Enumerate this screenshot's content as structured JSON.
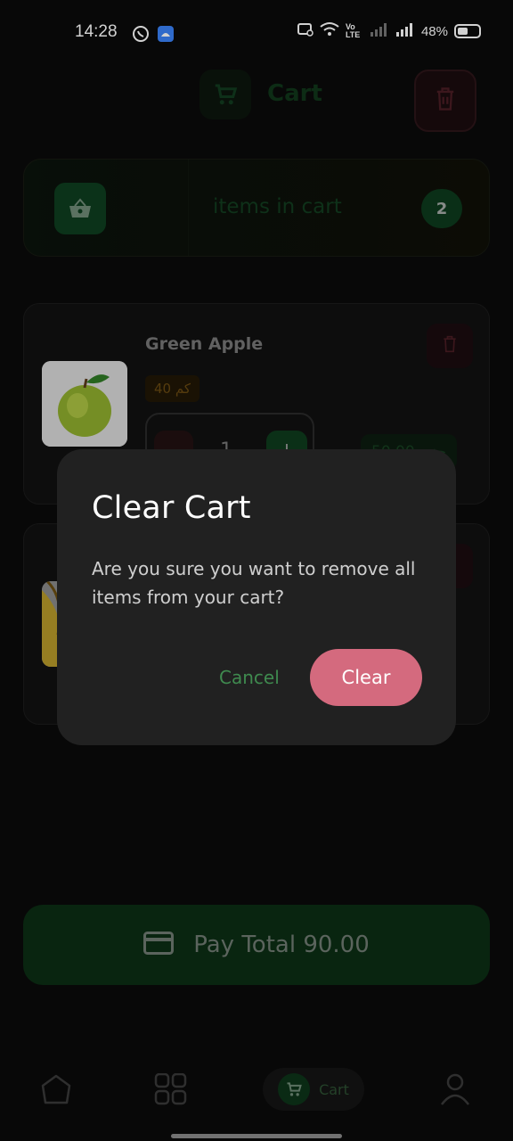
{
  "status_bar": {
    "time": "14:28",
    "battery_percent": "48%",
    "network_label": "Vo LTE"
  },
  "header": {
    "title": "Cart"
  },
  "summary": {
    "label": "items in cart",
    "count": "2"
  },
  "items": [
    {
      "name": "Green Apple",
      "unit": "40 كم",
      "quantity": "1",
      "price": "جنيه 50.00"
    },
    {
      "name": "",
      "unit": "",
      "quantity": "",
      "price": ""
    }
  ],
  "pay": {
    "label": "Pay Total 90.00"
  },
  "nav": {
    "cart_label": "Cart"
  },
  "dialog": {
    "title": "Clear Cart",
    "message": "Are you sure you want to remove all items from your cart?",
    "cancel_label": "Cancel",
    "confirm_label": "Clear"
  },
  "colors": {
    "accent_green": "#0e3b1d",
    "danger_pink": "#d46a7e",
    "dialog_bg": "#212121",
    "background": "#0a0a0a"
  },
  "icons": [
    "whatsapp-icon",
    "android-icon",
    "wifi-icon",
    "signal-icon",
    "battery-icon",
    "cart-icon",
    "trash-icon",
    "basket-icon",
    "credit-card-icon",
    "home-icon",
    "grid-icon",
    "user-icon"
  ]
}
